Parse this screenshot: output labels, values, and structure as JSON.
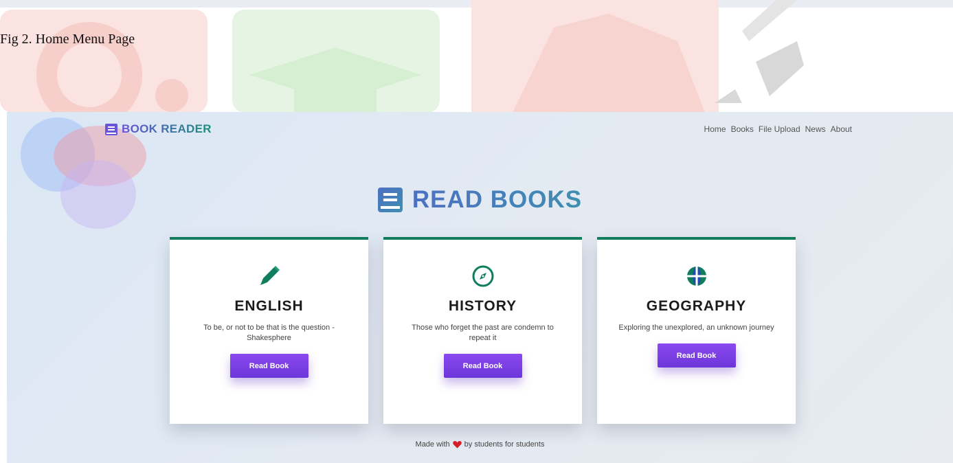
{
  "figure": {
    "caption": "Fig 2. Home Menu Page"
  },
  "brand": {
    "label": "BOOK READER",
    "icon": "book-icon"
  },
  "nav": {
    "items": [
      "Home",
      "Books",
      "File Upload",
      "News",
      "About"
    ]
  },
  "hero": {
    "title": "READ BOOKS",
    "icon": "book-icon"
  },
  "cards": [
    {
      "icon": "pencil-icon",
      "title": "ENGLISH",
      "description": "To be, or not to be that is the question - Shakesphere",
      "button": "Read Book"
    },
    {
      "icon": "compass-icon",
      "title": "HISTORY",
      "description": "Those who forget the past are condemn to repeat it",
      "button": "Read Book"
    },
    {
      "icon": "globe-icon",
      "title": "GEOGRAPHY",
      "description": "Exploring the unexplored, an unknown journey",
      "button": "Read Book"
    }
  ],
  "footer": {
    "before": "Made with",
    "after": "by students for students",
    "icon": "heart-icon"
  },
  "colors": {
    "accent": "#6d36d8",
    "card_border": "#0f7d5e",
    "heart": "#d0212b"
  }
}
